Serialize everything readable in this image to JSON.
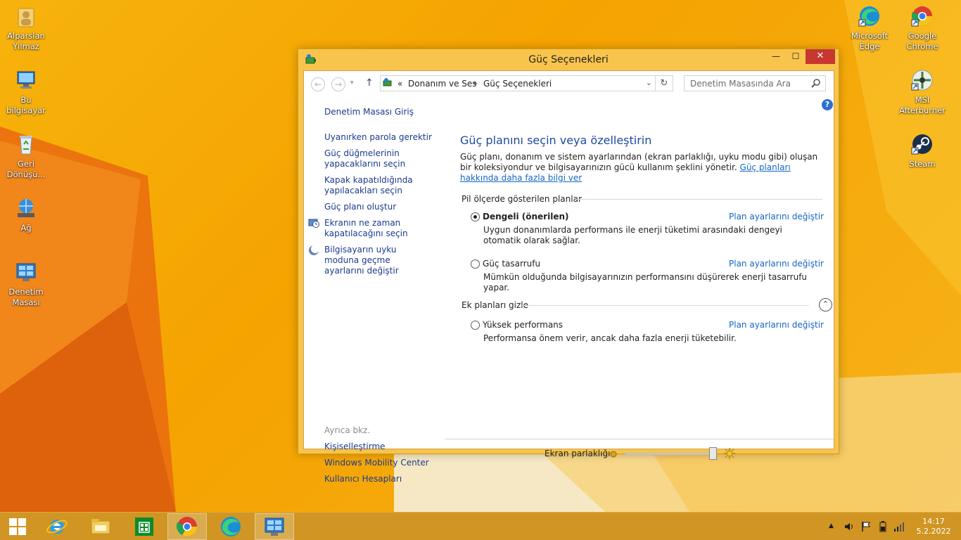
{
  "desktop": {
    "icons_left": [
      {
        "label": "Alparslan Yılmaz",
        "icon": "user-folder-icon"
      },
      {
        "label": "Bu bilgisayar",
        "icon": "computer-icon"
      },
      {
        "label": "Geri Dönüşü...",
        "icon": "recycle-bin-icon"
      },
      {
        "label": "Ağ",
        "icon": "network-icon"
      },
      {
        "label": "Denetim Masası",
        "icon": "control-panel-icon"
      }
    ],
    "icons_right": [
      {
        "label": "Microsoft Edge",
        "icon": "edge-icon"
      },
      {
        "label": "Google Chrome",
        "icon": "chrome-icon"
      },
      {
        "label": "MSI Afterburner",
        "icon": "msi-afterburner-icon"
      },
      {
        "label": "Steam",
        "icon": "steam-icon"
      }
    ]
  },
  "window": {
    "title": "Güç Seçenekleri",
    "controls": {
      "minimize": "—",
      "maximize": "☐",
      "close": "✕"
    },
    "address": {
      "prefix": "«",
      "crumb1": "Donanım ve Ses",
      "separator": "▸",
      "crumb2": "Güç Seçenekleri"
    },
    "search_placeholder": "Denetim Masasında Ara",
    "help": "?",
    "leftnav": {
      "home": "Denetim Masası Giriş",
      "items": [
        "Uyanırken parola gerektir",
        "Güç düğmelerinin yapacaklarını seçin",
        "Kapak kapatıldığında yapılacakları seçin",
        "Güç planı oluştur",
        "Ekranın ne zaman kapatılacağını seçin",
        "Bilgisayarın uyku moduna geçme ayarlarını değiştir"
      ],
      "see_also_title": "Ayrıca bkz.",
      "see_also": [
        "Kişiselleştirme",
        "Windows Mobility Center",
        "Kullanıcı Hesapları"
      ]
    },
    "main": {
      "heading": "Güç planını seçin veya özelleştirin",
      "intro": "Güç planı, donanım ve sistem ayarlarından (ekran parlaklığı, uyku modu gibi) oluşan bir koleksiyondur ve bilgisayarınızın gücü kullanım şeklini yönetir. ",
      "intro_link": "Güç planları hakkında daha fazla bilgi ver",
      "section_battery": "Pil ölçerde gösterilen planlar",
      "section_extra": "Ek planları gizle",
      "change_link": "Plan ayarlarını değiştir",
      "plans": [
        {
          "name": "Dengeli (önerilen)",
          "desc": "Uygun donanımlarda performans ile enerji tüketimi arasındaki dengeyi otomatik olarak sağlar.",
          "selected": true
        },
        {
          "name": "Güç tasarrufu",
          "desc": "Mümkün olduğunda bilgisayarınızın performansını düşürerek enerji tasarrufu yapar.",
          "selected": false
        },
        {
          "name": "Yüksek performans",
          "desc": "Performansa önem verir, ancak daha fazla enerji tüketebilir.",
          "selected": false
        }
      ],
      "brightness_label": "Ekran parlaklığı:",
      "brightness_level": 0.98
    }
  },
  "taskbar": {
    "apps": [
      "start-icon",
      "internet-explorer-icon",
      "file-explorer-icon",
      "store-icon",
      "chrome-icon",
      "edge-icon",
      "control-panel-icon"
    ],
    "time": "14:17",
    "date": "5.2.2022"
  },
  "colors": {
    "accent": "#f8c44c",
    "close": "#c7372f",
    "link": "#1466c4",
    "heading": "#1e4aa0"
  }
}
